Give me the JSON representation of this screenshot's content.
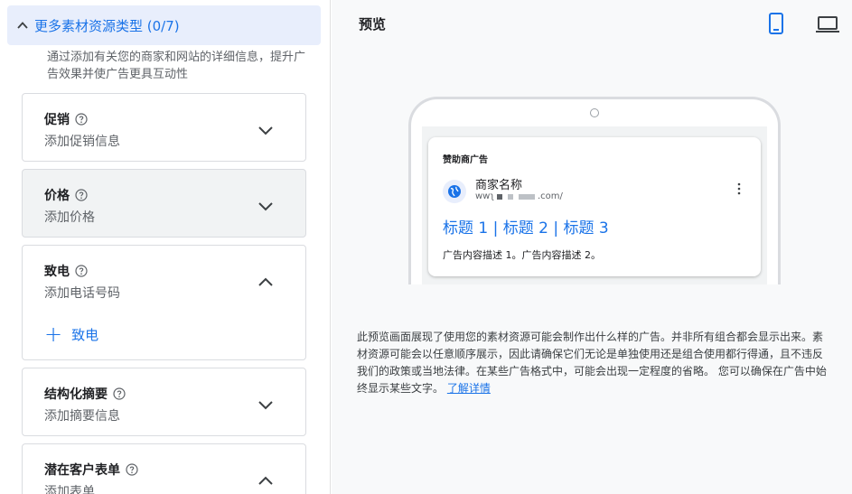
{
  "left": {
    "section_header": "更多素材资源类型 (0/7)",
    "intro": "通过添加有关您的商家和网站的详细信息，提升广告效果并使广告更具互动性",
    "cards": [
      {
        "title": "促销",
        "subtitle": "添加促销信息",
        "expanded": false
      },
      {
        "title": "价格",
        "subtitle": "添加价格",
        "expanded": false
      },
      {
        "title": "致电",
        "subtitle": "添加电话号码",
        "expanded": true,
        "add_label": "致电"
      },
      {
        "title": "结构化摘要",
        "subtitle": "添加摘要信息",
        "expanded": false
      },
      {
        "title": "潜在客户表单",
        "subtitle": "添加表单",
        "expanded": true
      }
    ]
  },
  "right": {
    "title": "预览",
    "icons": {
      "mobile": "mobile-device-icon",
      "desktop": "desktop-device-icon"
    },
    "ad": {
      "sponsored": "赞助商广告",
      "business_name": "商家名称",
      "url_prefix": "wwʅ",
      "url_suffix": ".com/",
      "headline": "标题 1 | 标题 2 | 标题 3",
      "description": "广告内容描述 1。广告内容描述 2。"
    },
    "disclaimer": "此预览画面展现了使用您的素材资源可能会制作出什么样的广告。并非所有组合都会显示出来。素材资源可能会以任意顺序展示，因此请确保它们无论是单独使用还是组合使用都行得通，且不违反我们的政策或当地法律。在某些广告格式中，可能会出现一定程度的省略。 您可以确保在广告中始终显示某些文字。",
    "learn_more": "了解详情"
  },
  "colors": {
    "accent": "#1a73e8",
    "header_bg": "#e8eefc",
    "card_gray": "#f1f3f4",
    "panel_bg": "#f8f9fa"
  }
}
